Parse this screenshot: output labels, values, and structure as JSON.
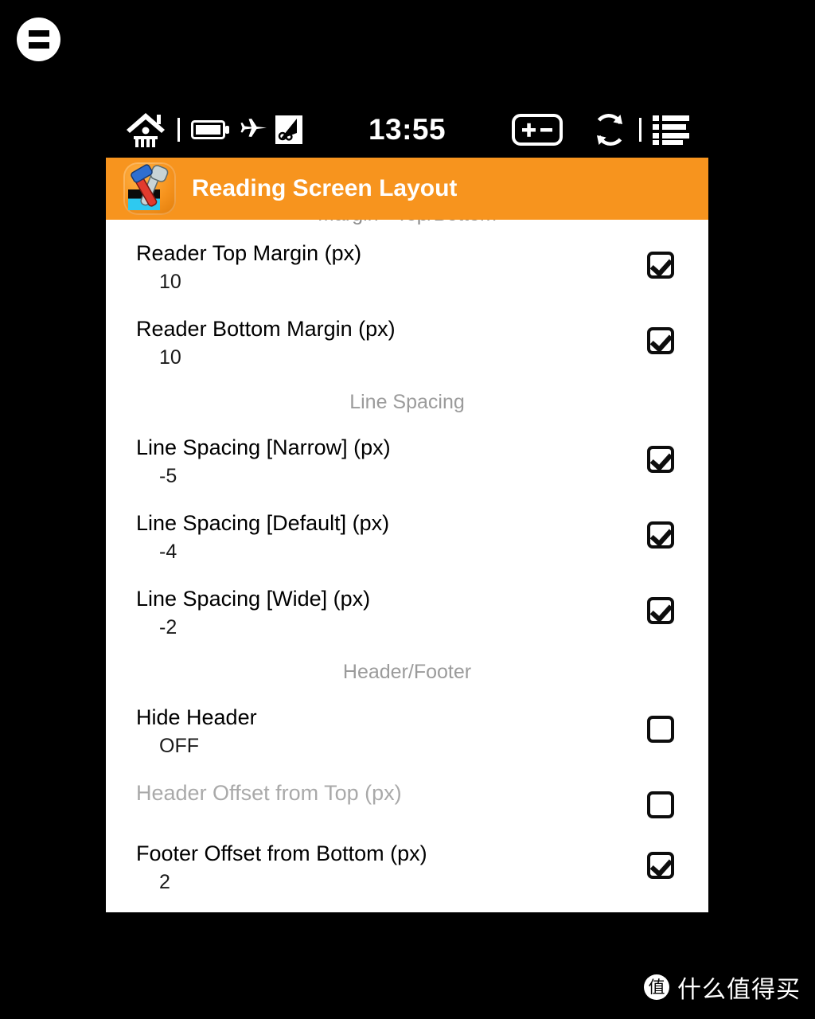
{
  "overlay": {
    "menu_badge_icon": "equals-menu-icon"
  },
  "statusbar": {
    "home_icon": "home-icon",
    "battery_icon": "battery-icon",
    "airplane_icon": "airplane-mode-icon",
    "wifi_off_icon": "wifi-off-icon",
    "time": "13:55",
    "contrast_icon": "plus-minus-contrast-icon",
    "refresh_icon": "refresh-icon",
    "list_icon": "list-menu-icon"
  },
  "titlebar": {
    "app_icon": "tools-app-icon",
    "title": "Reading Screen Layout",
    "accent_color": "#f7941e"
  },
  "list": {
    "clipped_section_header": "Margin - Top/Bottom",
    "sections": [
      {
        "header": null,
        "rows": [
          {
            "title": "Reader Top Margin (px)",
            "value": "10",
            "checked": true,
            "disabled": false
          },
          {
            "title": "Reader Bottom Margin (px)",
            "value": "10",
            "checked": true,
            "disabled": false
          }
        ]
      },
      {
        "header": "Line Spacing",
        "rows": [
          {
            "title": "Line Spacing [Narrow] (px)",
            "value": "-5",
            "checked": true,
            "disabled": false
          },
          {
            "title": "Line Spacing [Default] (px)",
            "value": "-4",
            "checked": true,
            "disabled": false
          },
          {
            "title": "Line Spacing [Wide] (px)",
            "value": "-2",
            "checked": true,
            "disabled": false
          }
        ]
      },
      {
        "header": "Header/Footer",
        "rows": [
          {
            "title": "Hide Header",
            "value": "OFF",
            "checked": false,
            "disabled": false
          },
          {
            "title": "Header Offset from Top (px)",
            "value": null,
            "checked": false,
            "disabled": true
          },
          {
            "title": "Footer Offset from Bottom (px)",
            "value": "2",
            "checked": true,
            "disabled": false
          }
        ]
      }
    ]
  },
  "watermark": {
    "badge": "值",
    "text": "什么值得买"
  }
}
